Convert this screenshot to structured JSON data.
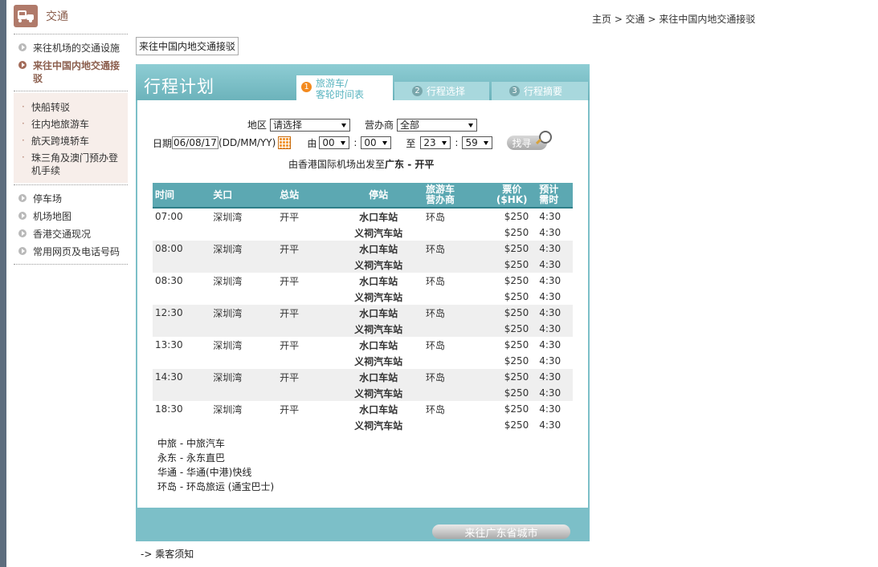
{
  "section": {
    "title": "交通"
  },
  "sidebar": {
    "items_top": [
      {
        "label": "来往机场的交通设施",
        "active": false
      },
      {
        "label": "来往中国内地交通接驳",
        "active": true
      }
    ],
    "sub_items": [
      "快船转驳",
      "往内地旅游车",
      "航天跨境轿车",
      "珠三角及澳门预办登机手续"
    ],
    "items_bottom": [
      "停车场",
      "机场地图",
      "香港交通现况",
      "常用网页及电话号码"
    ]
  },
  "breadcrumb": "主页 > 交通 > 来往中国内地交通接驳",
  "page_tab": "来往中国内地交通接驳",
  "panel": {
    "title": "行程计划",
    "tabs": [
      {
        "num": "1",
        "line1": "旅游车/",
        "line2": "客轮时间表"
      },
      {
        "num": "2",
        "label": "行程选择"
      },
      {
        "num": "3",
        "label": "行程摘要"
      }
    ]
  },
  "form": {
    "region_label": "地区",
    "region_value": "请选择",
    "operator_label": "营办商",
    "operator_value": "全部",
    "date_label": "日期",
    "date_value": "06/08/17",
    "date_format": "(DD/MM/YY)",
    "from_label": "由",
    "from_hour": "00",
    "from_min": "00",
    "colon": ":",
    "to_label": "至",
    "to_hour": "23",
    "to_min": "59",
    "search_label": "找寻"
  },
  "route": {
    "prefix": "由香港国际机场出发至",
    "dest": "广东 - 开平"
  },
  "table": {
    "headers": {
      "time": "时间",
      "checkpoint": "关口",
      "terminal": "总站",
      "stop": "停站",
      "operator1": "旅游车",
      "operator2": "营办商",
      "fare1": "票价",
      "fare2": "($HK)",
      "dur1": "预计",
      "dur2": "需时"
    },
    "stop_a": "水口车站",
    "stop_b": "义祠汽车站",
    "rows": [
      {
        "time": "07:00",
        "checkpoint": "深圳湾",
        "terminal": "开平",
        "operator": "环岛",
        "fare_a": "$250",
        "dur_a": "4:30",
        "fare_b": "$250",
        "dur_b": "4:30"
      },
      {
        "time": "08:00",
        "checkpoint": "深圳湾",
        "terminal": "开平",
        "operator": "环岛",
        "fare_a": "$250",
        "dur_a": "4:30",
        "fare_b": "$250",
        "dur_b": "4:30"
      },
      {
        "time": "08:30",
        "checkpoint": "深圳湾",
        "terminal": "开平",
        "operator": "环岛",
        "fare_a": "$250",
        "dur_a": "4:30",
        "fare_b": "$250",
        "dur_b": "4:30"
      },
      {
        "time": "12:30",
        "checkpoint": "深圳湾",
        "terminal": "开平",
        "operator": "环岛",
        "fare_a": "$250",
        "dur_a": "4:30",
        "fare_b": "$250",
        "dur_b": "4:30"
      },
      {
        "time": "13:30",
        "checkpoint": "深圳湾",
        "terminal": "开平",
        "operator": "环岛",
        "fare_a": "$250",
        "dur_a": "4:30",
        "fare_b": "$250",
        "dur_b": "4:30"
      },
      {
        "time": "14:30",
        "checkpoint": "深圳湾",
        "terminal": "开平",
        "operator": "环岛",
        "fare_a": "$250",
        "dur_a": "4:30",
        "fare_b": "$250",
        "dur_b": "4:30"
      },
      {
        "time": "18:30",
        "checkpoint": "深圳湾",
        "terminal": "开平",
        "operator": "环岛",
        "fare_a": "$250",
        "dur_a": "4:30",
        "fare_b": "$250",
        "dur_b": "4:30"
      }
    ]
  },
  "legend": [
    "中旅 - 中旅汽车",
    "永东 - 永东直巴",
    "华通 - 华通(中港)快线",
    "环岛 - 环岛旅运 (通宝巴士)"
  ],
  "footer_button": "来往广东省城市",
  "notice_link": "-> 乘客须知"
}
